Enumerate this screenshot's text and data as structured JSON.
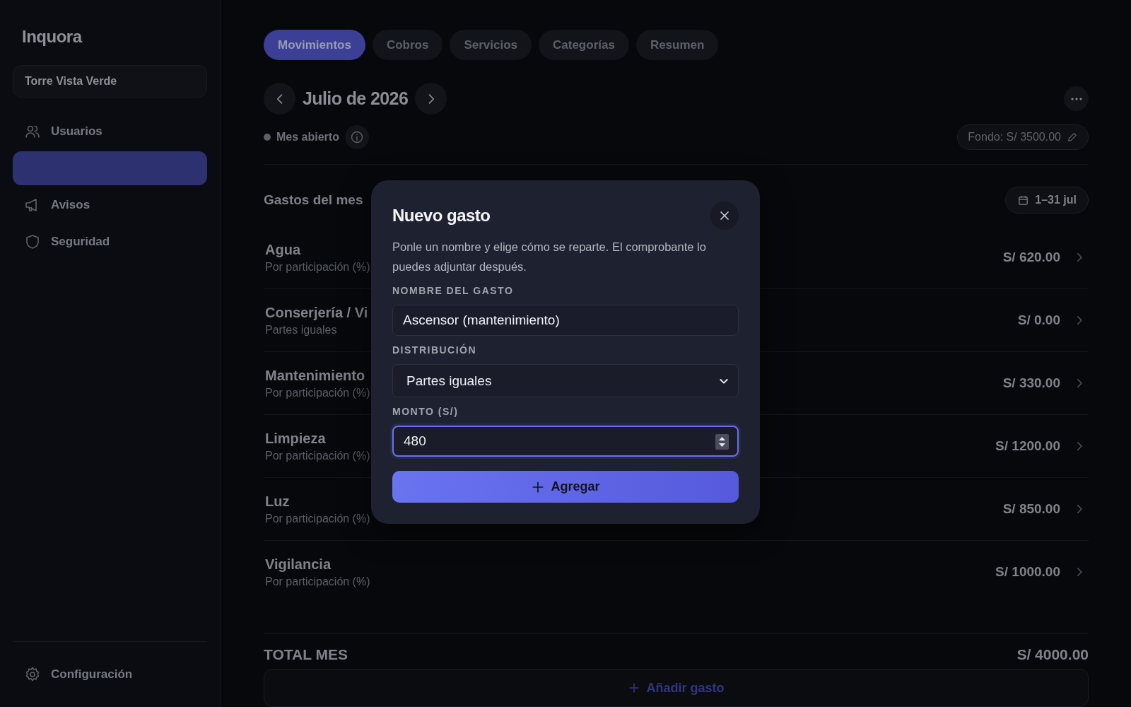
{
  "sidebar": {
    "brand": "Inquora",
    "building": "Torre Vista Verde",
    "items": [
      {
        "kind": "users",
        "label": "Usuarios",
        "selected": false
      },
      {
        "kind": "blank",
        "selected": true
      },
      {
        "kind": "megaphone",
        "label": "Avisos",
        "selected": false
      },
      {
        "kind": "shield",
        "label": "Seguridad",
        "selected": false
      }
    ],
    "footer": {
      "kind": "gear",
      "label": "Configuración"
    }
  },
  "tabs": [
    {
      "label": "Movimientos",
      "selected": true
    },
    {
      "label": "Cobros",
      "selected": false
    },
    {
      "label": "Servicios",
      "selected": false
    },
    {
      "label": "Categorías",
      "selected": false
    },
    {
      "label": "Resumen",
      "selected": false
    }
  ],
  "period": {
    "title": "Julio de 2026",
    "status": "Mes abierto",
    "fund": "Fondo: S/ 3500.00"
  },
  "expenses": {
    "title": "Gastos del mes",
    "range": "1–31 jul",
    "rows": [
      {
        "name": "Agua",
        "split": "Por participación (%)",
        "amount": "S/ 620.00"
      },
      {
        "name": "Conserjería / Vi",
        "split": "Partes iguales",
        "amount": "S/ 0.00"
      },
      {
        "name": "Mantenimiento",
        "split": "Por participación (%)",
        "amount": "S/ 330.00"
      },
      {
        "name": "Limpieza",
        "split": "Por participación (%)",
        "amount": "S/ 1200.00"
      },
      {
        "name": "Luz",
        "split": "Por participación (%)",
        "amount": "S/ 850.00"
      },
      {
        "name": "Vigilancia",
        "split": "Por participación (%)",
        "amount": "S/ 1000.00"
      }
    ],
    "total_label": "TOTAL MES",
    "total": "S/ 4000.00",
    "add_button": "Añadir gasto"
  },
  "dialog": {
    "title": "Nuevo gasto",
    "description": "Ponle un nombre y elige cómo se reparte. El comprobante lo puedes adjuntar después.",
    "fields": [
      {
        "kind": "text",
        "label": "NOMBRE DEL GASTO",
        "value": "Ascensor (mantenimiento)",
        "focused": false
      },
      {
        "kind": "select",
        "label": "DISTRIBUCIÓN",
        "value": "Partes iguales",
        "focused": false
      },
      {
        "kind": "number",
        "label": "MONTO (S/)",
        "value": "480",
        "focused": true
      }
    ],
    "submit": "Agregar"
  }
}
